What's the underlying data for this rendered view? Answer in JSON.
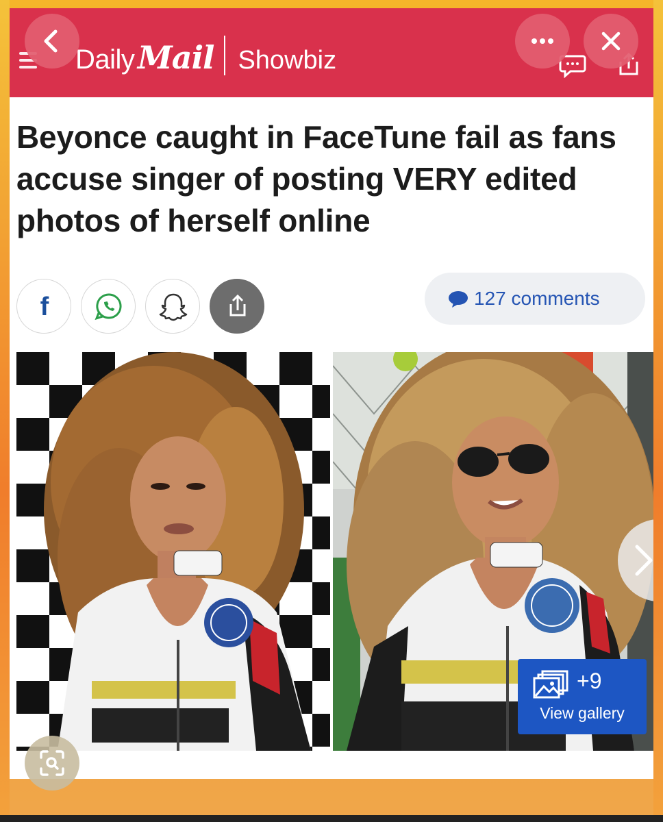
{
  "header": {
    "brand_daily": "Daily",
    "brand_mail": "Mail",
    "section": "Showbiz",
    "background_color": "#d9314c"
  },
  "overlay": {
    "back_icon": "chevron-left-icon",
    "more_icon": "more-horizontal-icon",
    "close_icon": "close-icon",
    "lens_icon": "visual-search-icon"
  },
  "article": {
    "headline": "Beyonce caught in FaceTune fail as fans accuse singer of posting VERY edited photos of herself online"
  },
  "share": {
    "facebook_glyph": "f",
    "icons": [
      "facebook-icon",
      "whatsapp-icon",
      "snapchat-icon",
      "share-icon"
    ]
  },
  "comments": {
    "label": "127 comments",
    "color": "#2454b3"
  },
  "gallery": {
    "count": "+9",
    "label": "View gallery",
    "color": "#1d56c3"
  }
}
